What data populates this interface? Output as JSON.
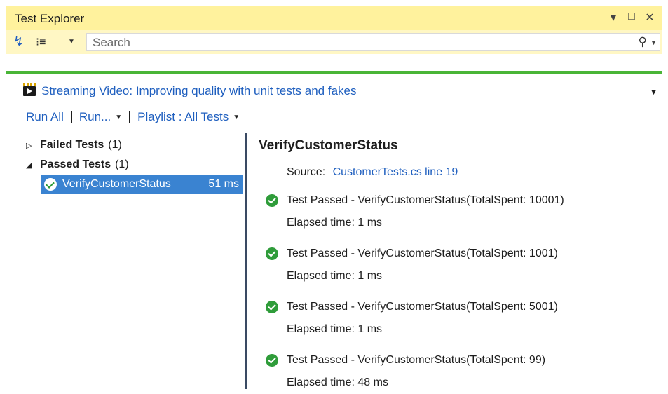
{
  "window": {
    "title": "Test Explorer",
    "controls": [
      "▾",
      "□",
      "✕"
    ]
  },
  "toolbar": {
    "icons": [
      "run-tests-icon",
      "group-by-icon"
    ],
    "search_placeholder": "Search"
  },
  "promo": {
    "icon": "video-icon",
    "text": "Streaming Video: Improving quality with unit tests and fakes"
  },
  "actions": {
    "run_all": "Run All",
    "run": "Run...",
    "playlist": "Playlist : All Tests"
  },
  "tree": {
    "failed": {
      "label": "Failed Tests",
      "count": "(1)"
    },
    "passed": {
      "label": "Passed Tests",
      "count": "(1)"
    },
    "selected_test": {
      "name": "VerifyCustomerStatus",
      "time": "51 ms"
    }
  },
  "details": {
    "title": "VerifyCustomerStatus",
    "source_label": "Source:",
    "source_link": "CustomerTests.cs line 19",
    "results": [
      {
        "text": "Test Passed - VerifyCustomerStatus(TotalSpent: 10001)",
        "elapsed": "Elapsed time: 1 ms"
      },
      {
        "text": "Test Passed - VerifyCustomerStatus(TotalSpent: 1001)",
        "elapsed": "Elapsed time: 1 ms"
      },
      {
        "text": "Test Passed - VerifyCustomerStatus(TotalSpent: 5001)",
        "elapsed": "Elapsed time: 1 ms"
      },
      {
        "text": "Test Passed - VerifyCustomerStatus(TotalSpent: 99)",
        "elapsed": "Elapsed time: 48 ms"
      }
    ]
  },
  "colors": {
    "title_bar": "#fff29d",
    "toolbar": "#fff7c4",
    "status_bar": "#49b537",
    "link": "#1f5fbf",
    "selection": "#3a83d1",
    "pass_icon": "#2f9c3a"
  }
}
